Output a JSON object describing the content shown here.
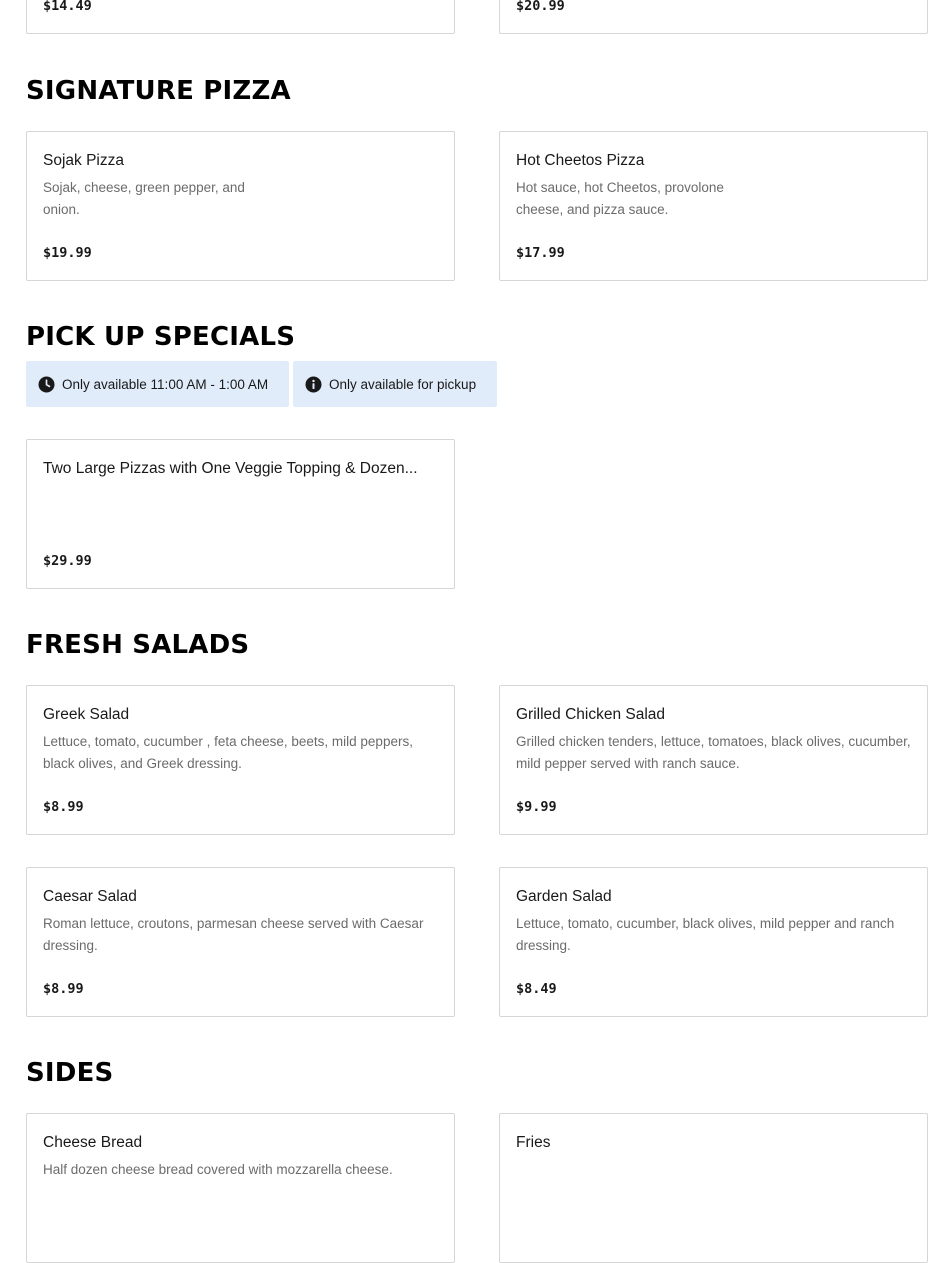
{
  "top_cards": [
    {
      "price": "$14.49"
    },
    {
      "price": "$20.99"
    }
  ],
  "sections": {
    "signature_pizza": {
      "title": "SIGNATURE PIZZA",
      "items": [
        {
          "name": "Sojak Pizza",
          "description": "Sojak, cheese, green pepper, and onion.",
          "price": "$19.99"
        },
        {
          "name": "Hot Cheetos Pizza",
          "description": "Hot sauce, hot Cheetos, provolone cheese, and pizza sauce.",
          "price": "$17.99"
        }
      ]
    },
    "pick_up_specials": {
      "title": "PICK UP SPECIALS",
      "badges": [
        {
          "icon": "clock-icon",
          "text": "Only available 11:00 AM - 1:00 AM"
        },
        {
          "icon": "info-icon",
          "text": "Only available for pickup"
        }
      ],
      "items": [
        {
          "name": "Two Large Pizzas with One Veggie Topping & Dozen...",
          "price": "$29.99"
        }
      ]
    },
    "fresh_salads": {
      "title": "FRESH SALADS",
      "items": [
        {
          "name": "Greek Salad",
          "description": "Lettuce, tomato, cucumber , feta cheese, beets, mild peppers, black olives, and Greek dressing.",
          "price": "$8.99"
        },
        {
          "name": "Grilled Chicken Salad",
          "description": "Grilled chicken tenders, lettuce, tomatoes, black olives, cucumber, mild pepper served with ranch sauce.",
          "price": "$9.99"
        },
        {
          "name": "Caesar Salad",
          "description": "Roman lettuce, croutons, parmesan cheese served with Caesar dressing.",
          "price": "$8.99"
        },
        {
          "name": "Garden Salad",
          "description": "Lettuce, tomato, cucumber, black olives, mild pepper and ranch dressing.",
          "price": "$8.49"
        }
      ]
    },
    "sides": {
      "title": "SIDES",
      "items": [
        {
          "name": "Cheese Bread",
          "description": "Half dozen cheese bread covered with mozzarella cheese."
        },
        {
          "name": "Fries"
        }
      ]
    }
  },
  "colors": {
    "badge_background": "#e1ecfa",
    "card_border": "#d6d6d6",
    "description_text": "#6b6b6b"
  }
}
